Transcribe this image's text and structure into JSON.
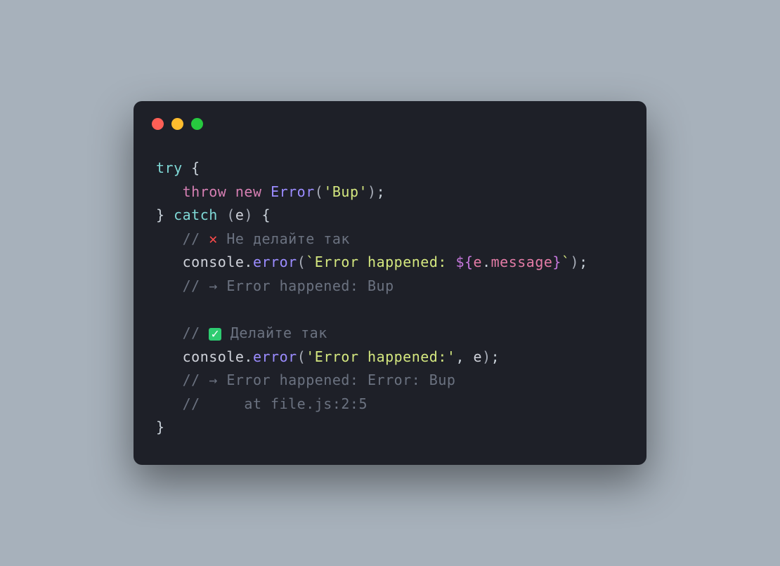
{
  "code": {
    "l1": {
      "try": "try",
      "brace": " {"
    },
    "l2": {
      "indent": "   ",
      "throw": "throw",
      "sp1": " ",
      "new": "new",
      "sp2": " ",
      "class": "Error",
      "open": "(",
      "str": "'Bup'",
      "close": ")",
      "semi": ";"
    },
    "l3": {
      "close_brace": "}",
      "sp": " ",
      "catch": "catch",
      "sp2": " ",
      "open": "(",
      "var": "e",
      "close": ")",
      "sp3": " ",
      "brace": "{"
    },
    "l4": {
      "indent": "   ",
      "slash": "// ",
      "emoji": "✕",
      "rest": " Не делайте так"
    },
    "l5": {
      "indent": "   ",
      "obj": "console",
      "dot": ".",
      "method": "error",
      "open": "(",
      "tick1": "`",
      "tmpl1": "Error happened: ",
      "interp_open": "${",
      "e": "e",
      "dot2": ".",
      "msg": "message",
      "interp_close": "}",
      "tick2": "`",
      "close": ")",
      "semi": ";"
    },
    "l6": {
      "indent": "   ",
      "text": "// → Error happened: Bup"
    },
    "l7": {
      "blank": " "
    },
    "l8": {
      "indent": "   ",
      "slash": "// ",
      "emoji": "✓",
      "rest": " Делайте так"
    },
    "l9": {
      "indent": "   ",
      "obj": "console",
      "dot": ".",
      "method": "error",
      "open": "(",
      "str": "'Error happened:'",
      "comma": ", ",
      "var": "e",
      "close": ")",
      "semi": ";"
    },
    "l10": {
      "indent": "   ",
      "text": "// → Error happened: Error: Bup"
    },
    "l11": {
      "indent": "   ",
      "text": "//     at file.js:2:5"
    },
    "l12": {
      "brace": "}"
    }
  }
}
